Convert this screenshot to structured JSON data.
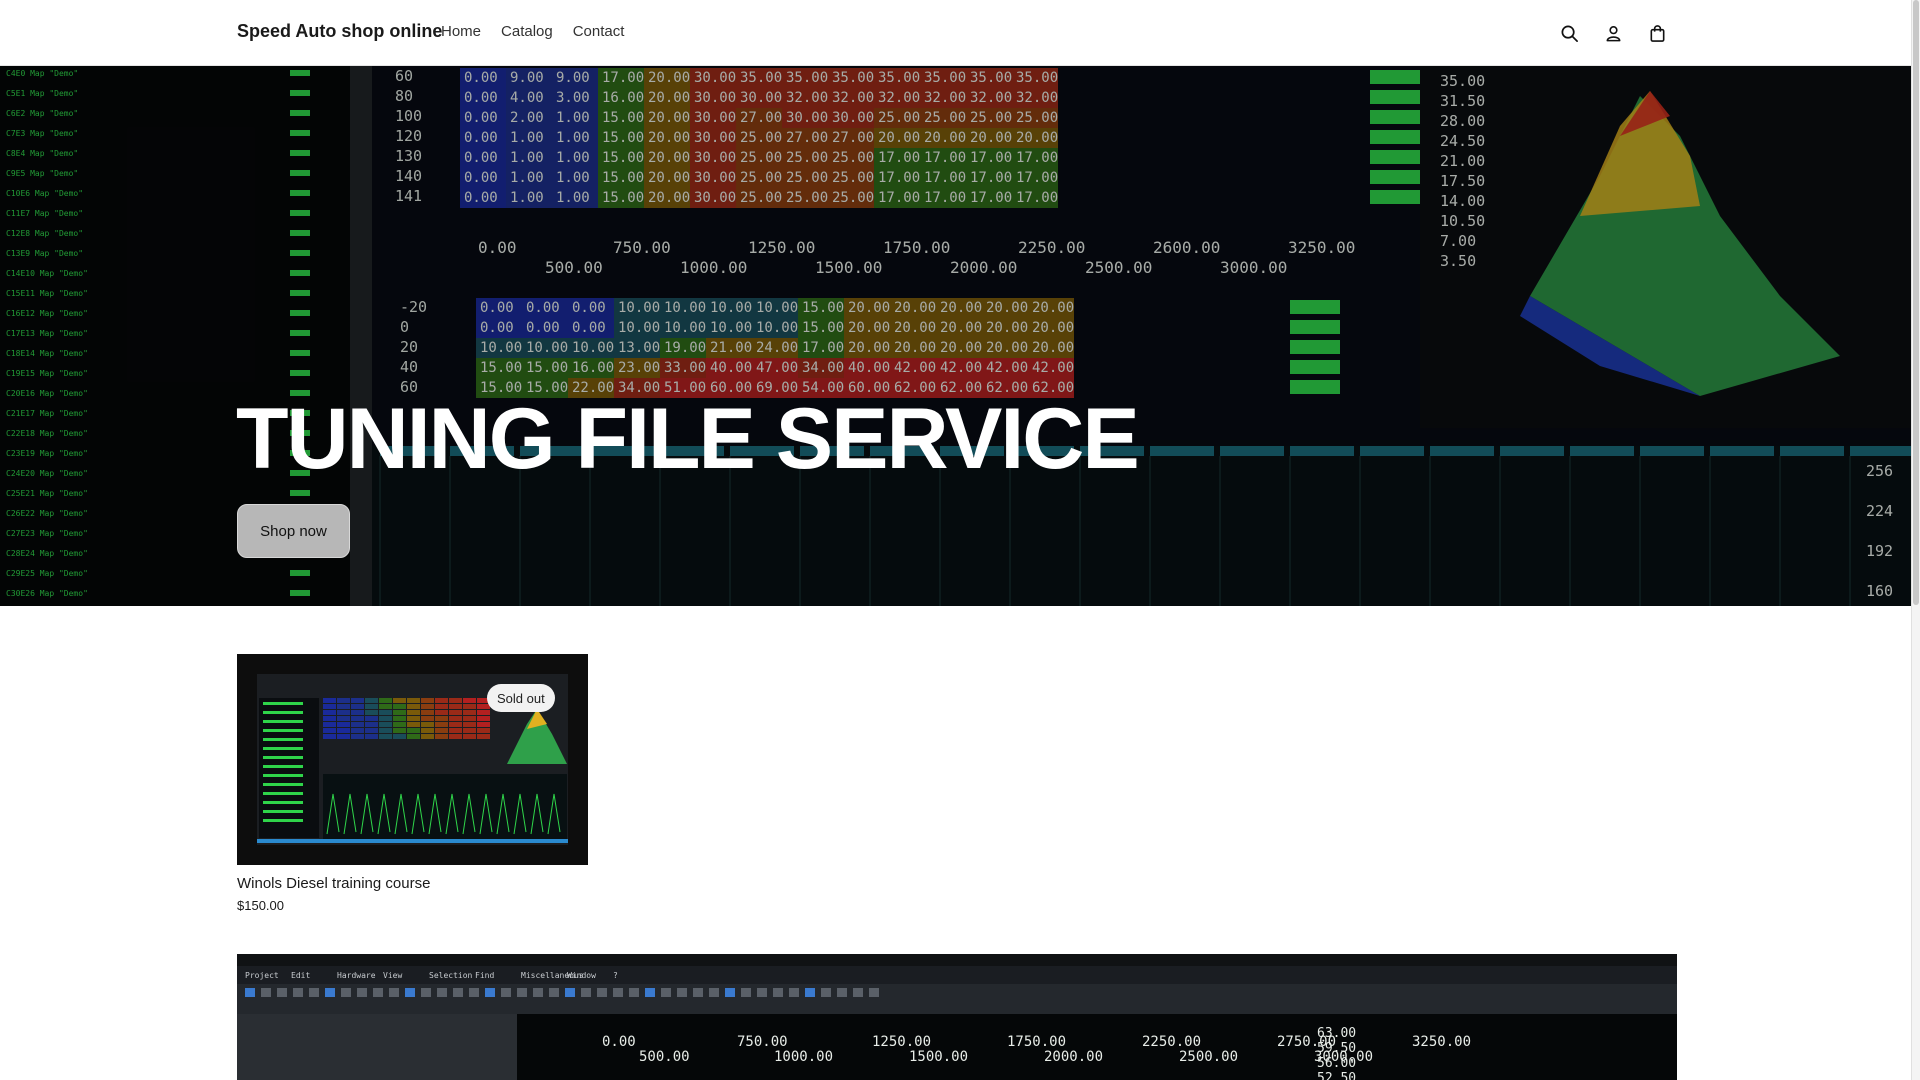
{
  "header": {
    "brand": "Speed Auto shop online",
    "nav": [
      "Home",
      "Catalog",
      "Contact"
    ],
    "icons": [
      "search-icon",
      "account-icon",
      "cart-icon"
    ]
  },
  "hero": {
    "title": "TUNING FILE SERVICE",
    "button_label": "Shop now",
    "map_rows": [
      {
        "label": "60",
        "values": [
          "0.00",
          "9.00",
          "9.00",
          "17.00",
          "20.00",
          "30.00",
          "35.00",
          "35.00",
          "35.00",
          "35.00",
          "35.00",
          "35.00",
          "35.00"
        ]
      },
      {
        "label": "80",
        "values": [
          "0.00",
          "4.00",
          "3.00",
          "16.00",
          "20.00",
          "30.00",
          "30.00",
          "32.00",
          "32.00",
          "32.00",
          "32.00",
          "32.00",
          "32.00"
        ]
      },
      {
        "label": "100",
        "values": [
          "0.00",
          "2.00",
          "1.00",
          "15.00",
          "20.00",
          "30.00",
          "27.00",
          "30.00",
          "30.00",
          "25.00",
          "25.00",
          "25.00",
          "25.00"
        ]
      },
      {
        "label": "120",
        "values": [
          "0.00",
          "1.00",
          "1.00",
          "15.00",
          "20.00",
          "30.00",
          "25.00",
          "27.00",
          "27.00",
          "20.00",
          "20.00",
          "20.00",
          "20.00"
        ]
      },
      {
        "label": "130",
        "values": [
          "0.00",
          "1.00",
          "1.00",
          "15.00",
          "20.00",
          "30.00",
          "25.00",
          "25.00",
          "25.00",
          "17.00",
          "17.00",
          "17.00",
          "17.00"
        ]
      },
      {
        "label": "140",
        "values": [
          "0.00",
          "1.00",
          "1.00",
          "15.00",
          "20.00",
          "30.00",
          "25.00",
          "25.00",
          "25.00",
          "17.00",
          "17.00",
          "17.00",
          "17.00"
        ]
      },
      {
        "label": "141",
        "values": [
          "0.00",
          "1.00",
          "1.00",
          "15.00",
          "20.00",
          "30.00",
          "25.00",
          "25.00",
          "25.00",
          "17.00",
          "17.00",
          "17.00",
          "17.00"
        ]
      }
    ],
    "axis_top": [
      "0.00",
      "750.00",
      "1250.00",
      "1750.00",
      "2250.00",
      "2600.00",
      "3250.00"
    ],
    "axis_bottom": [
      "500.00",
      "1000.00",
      "1500.00",
      "2000.00",
      "2500.00",
      "3000.00"
    ],
    "lower_rows": [
      {
        "label": "-20",
        "values": [
          "0.00",
          "0.00",
          "0.00",
          "10.00",
          "10.00",
          "10.00",
          "10.00",
          "15.00",
          "20.00",
          "20.00",
          "20.00",
          "20.00",
          "20.00"
        ]
      },
      {
        "label": "0",
        "values": [
          "0.00",
          "0.00",
          "0.00",
          "10.00",
          "10.00",
          "10.00",
          "10.00",
          "15.00",
          "20.00",
          "20.00",
          "20.00",
          "20.00",
          "20.00"
        ]
      },
      {
        "label": "20",
        "values": [
          "10.00",
          "10.00",
          "10.00",
          "13.00",
          "19.00",
          "21.00",
          "24.00",
          "17.00",
          "20.00",
          "20.00",
          "20.00",
          "20.00",
          "20.00"
        ]
      },
      {
        "label": "40",
        "values": [
          "15.00",
          "15.00",
          "16.00",
          "23.00",
          "33.00",
          "40.00",
          "47.00",
          "34.00",
          "40.00",
          "42.00",
          "42.00",
          "42.00",
          "42.00"
        ]
      },
      {
        "label": "60",
        "values": [
          "15.00",
          "15.00",
          "22.00",
          "34.00",
          "51.00",
          "60.00",
          "69.00",
          "54.00",
          "60.00",
          "62.00",
          "62.00",
          "62.00",
          "62.00"
        ]
      }
    ],
    "scale_values": [
      "35.00",
      "31.50",
      "28.00",
      "24.50",
      "21.00",
      "17.50",
      "14.00",
      "10.50",
      "7.00",
      "3.50"
    ],
    "right_values": [
      "256",
      "224",
      "192",
      "160"
    ]
  },
  "product": {
    "title": "Winols Diesel training course",
    "price": "$150.00",
    "badge": "Sold out"
  },
  "banner": {
    "menu": [
      "Project",
      "Edit",
      "Hardware",
      "View",
      "Selection",
      "Find",
      "Miscellaneous",
      "Window",
      "?"
    ],
    "axis_top": [
      "0.00",
      "750.00",
      "1250.00",
      "1750.00",
      "2250.00",
      "2750.00",
      "3250.00"
    ],
    "axis_bottom": [
      "500.00",
      "1000.00",
      "1500.00",
      "2000.00",
      "2500.00",
      "3000.00"
    ],
    "scale_values": [
      "63.00",
      "59.50",
      "56.00",
      "52.50"
    ]
  }
}
